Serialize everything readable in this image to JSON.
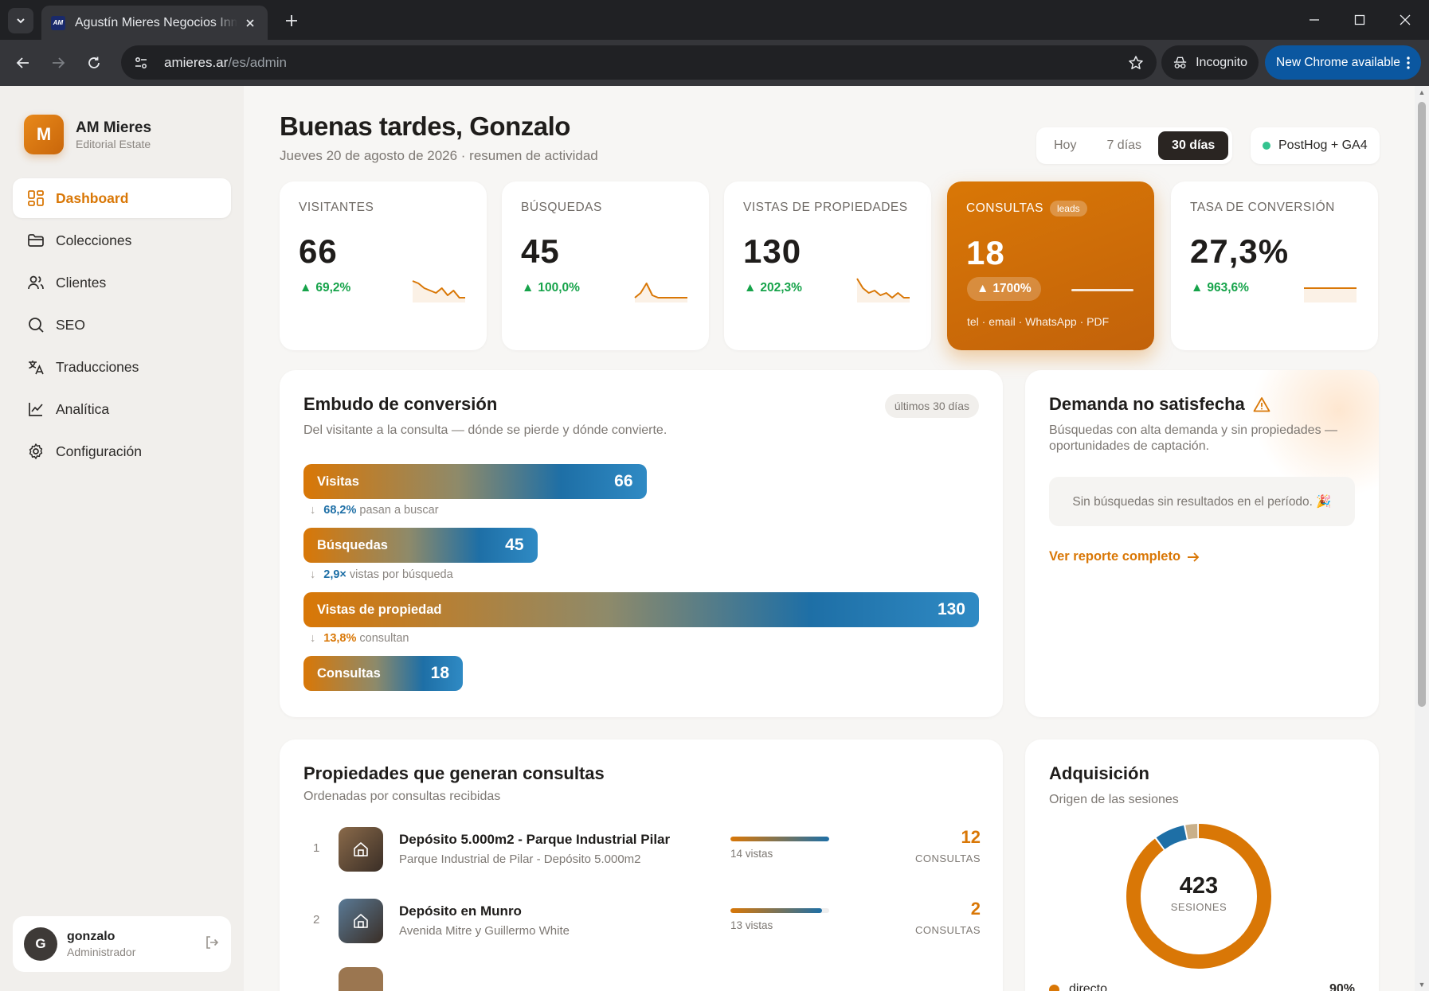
{
  "browser": {
    "tab_title": "Agustín Mieres Negocios Inmobiliarios",
    "favicon_text": "AM",
    "url_host": "amieres.ar",
    "url_path": "/es/admin",
    "incognito_label": "Incognito",
    "update_label": "New Chrome available"
  },
  "sidebar": {
    "brand_initial": "M",
    "brand_name": "AM Mieres",
    "brand_sub": "Editorial Estate",
    "items": [
      {
        "label": "Dashboard",
        "icon": "dashboard-icon",
        "active": true
      },
      {
        "label": "Colecciones",
        "icon": "folder-icon"
      },
      {
        "label": "Clientes",
        "icon": "users-icon"
      },
      {
        "label": "SEO",
        "icon": "search-icon"
      },
      {
        "label": "Traducciones",
        "icon": "translate-icon"
      },
      {
        "label": "Analítica",
        "icon": "chart-line-icon"
      },
      {
        "label": "Configuración",
        "icon": "gear-icon"
      }
    ],
    "user": {
      "initial": "G",
      "name": "gonzalo",
      "role": "Administrador"
    }
  },
  "header": {
    "greeting": "Buenas tardes, Gonzalo",
    "date_line": "Jueves 20 de agosto de 2026 · resumen de actividad",
    "ranges": [
      "Hoy",
      "7 días",
      "30 días"
    ],
    "active_range": "30 días",
    "source_label": "PostHog + GA4"
  },
  "kpis": [
    {
      "label": "VISITANTES",
      "value": "66",
      "delta": "69,2%",
      "spark": [
        0.2,
        0.3,
        0.5,
        0.6,
        0.7,
        0.5,
        0.8,
        0.6,
        0.9,
        0.9
      ]
    },
    {
      "label": "BÚSQUEDAS",
      "value": "45",
      "delta": "100,0%",
      "spark": [
        0.9,
        0.7,
        0.3,
        0.8,
        0.9,
        0.9,
        0.9,
        0.9,
        0.9,
        0.9
      ]
    },
    {
      "label": "VISTAS DE PROPIEDADES",
      "value": "130",
      "delta": "202,3%",
      "spark": [
        0.1,
        0.5,
        0.7,
        0.6,
        0.8,
        0.7,
        0.9,
        0.7,
        0.9,
        0.9
      ]
    },
    {
      "label": "CONSULTAS",
      "badge": "leads",
      "value": "18",
      "delta": "1700%",
      "channels": "tel · email · WhatsApp · PDF"
    },
    {
      "label": "TASA DE CONVERSIÓN",
      "value": "27,3%",
      "delta": "963,6%",
      "spark": [
        0.5,
        0.5,
        0.5,
        0.5,
        0.5,
        0.5,
        0.5,
        0.5,
        0.5,
        0.5
      ]
    }
  ],
  "funnel": {
    "title": "Embudo de conversión",
    "subtitle": "Del visitante a la consulta — dónde se pierde y dónde convierte.",
    "badge": "últimos 30 días",
    "stages": [
      {
        "label": "Visitas",
        "value": 66
      },
      {
        "label": "Búsquedas",
        "value": 45
      },
      {
        "label": "Vistas de propiedad",
        "value": 130
      },
      {
        "label": "Consultas",
        "value": 18
      }
    ],
    "notes": [
      {
        "strong": "68,2%",
        "text": "pasan a buscar"
      },
      {
        "strong": "2,9×",
        "text": "vistas por búsqueda"
      },
      {
        "strong": "13,8%",
        "text": "consultan"
      }
    ]
  },
  "demand": {
    "title": "Demanda no satisfecha",
    "subtitle": "Búsquedas con alta demanda y sin propiedades — oportunidades de captación.",
    "empty_text": "Sin búsquedas sin resultados en el período. 🎉",
    "link": "Ver reporte completo"
  },
  "properties": {
    "title": "Propiedades que generan consultas",
    "subtitle": "Ordenadas por consultas recibidas",
    "rows": [
      {
        "rank": "1",
        "name": "Depósito 5.000m2 - Parque Industrial Pilar",
        "address": "Parque Industrial de Pilar - Depósito 5.000m2",
        "views": "14 vistas",
        "views_fraction": 1.0,
        "count": "12",
        "count_label": "CONSULTAS",
        "thumb_color": "#8a6a4a"
      },
      {
        "rank": "2",
        "name": "Depósito en Munro",
        "address": "Avenida Mitre y Guillermo White",
        "views": "13 vistas",
        "views_fraction": 0.93,
        "count": "2",
        "count_label": "CONSULTAS",
        "thumb_color": "#5a7a96"
      }
    ]
  },
  "acquisition": {
    "title": "Adquisición",
    "subtitle": "Origen de las sesiones",
    "total": "423",
    "total_label": "SESIONES",
    "segments": [
      {
        "name": "directo",
        "pct": "90%",
        "color": "#d97706",
        "value": 90
      },
      {
        "name": "",
        "pct": "",
        "color": "#1e6fa6",
        "value": 7
      },
      {
        "name": "",
        "pct": "",
        "color": "#c9b08a",
        "value": 3
      }
    ]
  }
}
